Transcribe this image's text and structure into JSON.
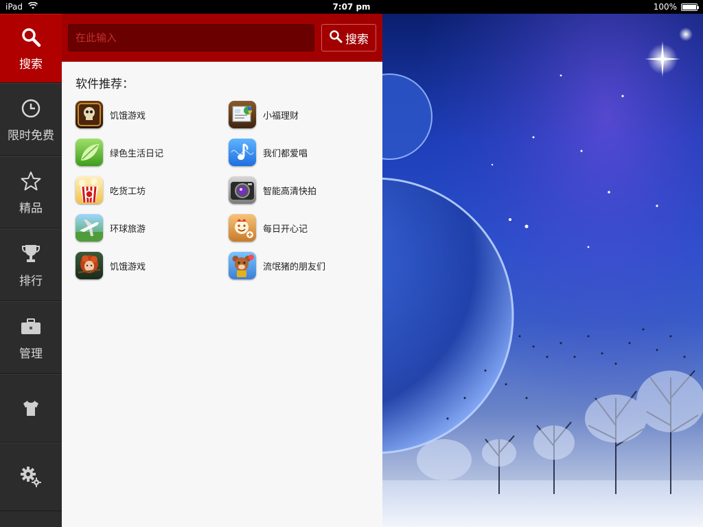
{
  "status_bar": {
    "device": "iPad",
    "time": "7:07 pm",
    "battery": "100%",
    "battery_level": 1.0
  },
  "sidebar": {
    "items": [
      {
        "label": "搜索",
        "icon": "search-icon",
        "active": true
      },
      {
        "label": "限时免费",
        "icon": "clock-icon",
        "active": false
      },
      {
        "label": "精品",
        "icon": "star-icon",
        "active": false
      },
      {
        "label": "排行",
        "icon": "trophy-icon",
        "active": false
      },
      {
        "label": "管理",
        "icon": "briefcase-icon",
        "active": false
      },
      {
        "label": "",
        "icon": "tshirt-icon",
        "active": false
      },
      {
        "label": "",
        "icon": "gear-icon",
        "active": false
      }
    ]
  },
  "search": {
    "placeholder": "在此输入",
    "value": "",
    "button_label": "搜索"
  },
  "recommend": {
    "title": "软件推荐：",
    "apps": [
      {
        "name": "饥饿游戏",
        "icon": "skull-game-icon"
      },
      {
        "name": "小福理财",
        "icon": "finance-icon"
      },
      {
        "name": "绿色生活日记",
        "icon": "leaf-icon"
      },
      {
        "name": "我们都爱唱",
        "icon": "music-note-icon"
      },
      {
        "name": "吃货工坊",
        "icon": "popcorn-icon"
      },
      {
        "name": "智能高清快拍",
        "icon": "camera-icon"
      },
      {
        "name": "环球旅游",
        "icon": "airplane-icon"
      },
      {
        "name": "每日开心记",
        "icon": "smiley-icon"
      },
      {
        "name": "饥饿游戏",
        "icon": "archer-icon"
      },
      {
        "name": "流氓猪的朋友们",
        "icon": "bear-icon"
      }
    ]
  },
  "colors": {
    "accent": "#a20000",
    "active_nav": "#b00000",
    "sidebar_bg": "#2c2c2c"
  }
}
